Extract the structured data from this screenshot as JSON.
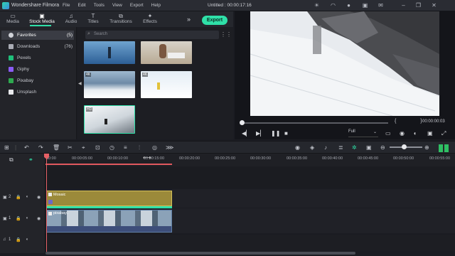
{
  "titlebar": {
    "app_name": "Wondershare Filmora",
    "menu": [
      "File",
      "Edit",
      "Tools",
      "View",
      "Export",
      "Help"
    ],
    "document": "Untitled : 00:00:17:16",
    "icons": [
      "sun-icon",
      "headphones-icon",
      "account-icon",
      "save-icon",
      "mail-icon",
      "minimize-icon",
      "restore-icon",
      "close-icon"
    ]
  },
  "tabs": [
    {
      "label": "Media",
      "icon": "folder-icon"
    },
    {
      "label": "Stock Media",
      "icon": "stock-icon",
      "active": true
    },
    {
      "label": "Audio",
      "icon": "music-icon"
    },
    {
      "label": "Titles",
      "icon": "titles-icon"
    },
    {
      "label": "Transitions",
      "icon": "transitions-icon"
    },
    {
      "label": "Effects",
      "icon": "effects-icon"
    }
  ],
  "export_label": "Export",
  "sidebar": [
    {
      "label": "Favorites",
      "count": "(5)",
      "selected": true,
      "icon": "heart-icon",
      "color": "#d0d2d8"
    },
    {
      "label": "Downloads",
      "count": "(76)",
      "icon": "download-icon",
      "color": "#d0d2d8"
    },
    {
      "label": "Pexels",
      "count": "",
      "icon": "pexels-icon",
      "color": "#1fbf7a"
    },
    {
      "label": "Giphy",
      "count": "",
      "icon": "giphy-icon",
      "color": "#8a5cf5"
    },
    {
      "label": "Pixabay",
      "count": "",
      "icon": "pixabay-icon",
      "color": "#2ea94f"
    },
    {
      "label": "Unsplash",
      "count": "",
      "icon": "unsplash-icon",
      "color": "#e8e9ec"
    }
  ],
  "search": {
    "placeholder": "Search"
  },
  "thumbs": [
    {
      "badge": "",
      "name": "thumb-skier-blue"
    },
    {
      "badge": "",
      "name": "thumb-person-laptop"
    },
    {
      "badge": "4K",
      "name": "thumb-mountain-snow"
    },
    {
      "badge": "4K",
      "name": "thumb-skier-yellow"
    },
    {
      "badge": "HD",
      "name": "thumb-skier-slope"
    }
  ],
  "preview": {
    "timecode": "00:00:00:03",
    "braces": "{ }",
    "quality": "Full",
    "progress": 0.01
  },
  "ruler_labels": [
    "00:00",
    "00:00:05:00",
    "00:00:10:00",
    "00:00:15:00",
    "00:00:20:00",
    "00:00:25:00",
    "00:00:30:00",
    "00:00:35:00",
    "00:00:40:00",
    "00:00:45:00",
    "00:00:50:00",
    "00:00:55:00"
  ],
  "tracks": [
    {
      "num": "2",
      "name": "track-2"
    },
    {
      "num": "1",
      "name": "track-1"
    },
    {
      "num": "1",
      "name": "audio-track-1"
    }
  ],
  "clips": {
    "mosaic": "Mosaic",
    "video": "pixabay.."
  },
  "colors": {
    "accent": "#2fe0a8",
    "playhead": "#e56065",
    "mosaic_clip": "#9b8a3a",
    "video_clip": "#27405a"
  }
}
